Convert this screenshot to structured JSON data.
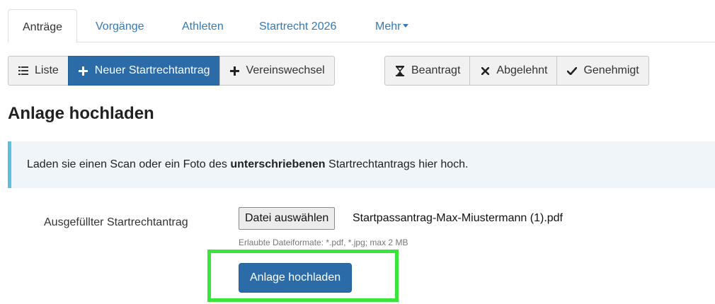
{
  "tabs": [
    {
      "label": "Anträge"
    },
    {
      "label": "Vorgänge"
    },
    {
      "label": "Athleten"
    },
    {
      "label": "Startrecht 2026"
    },
    {
      "label": "Mehr"
    }
  ],
  "toolbar": {
    "list": {
      "label": "Liste",
      "icon": "list-icon"
    },
    "new_application": {
      "label": "Neuer Startrechtantrag",
      "icon": "plus-icon"
    },
    "club_change": {
      "label": "Vereinswechsel",
      "icon": "plus-icon"
    },
    "requested": {
      "label": "Beantragt",
      "icon": "hourglass-icon"
    },
    "rejected": {
      "label": "Abgelehnt",
      "icon": "x-icon"
    },
    "approved": {
      "label": "Genehmigt",
      "icon": "check-icon"
    }
  },
  "page_title": "Anlage hochladen",
  "alert": {
    "text_before": "Laden sie einen Scan oder ein Foto des ",
    "text_bold": "unterschriebenen",
    "text_after": " Startrechtantrags hier hoch."
  },
  "form": {
    "label": "Ausgefüllter Startrechtantrag",
    "file_button": "Datei auswählen",
    "file_name": "Startpassantrag-Max-Miustermann (1).pdf",
    "help": "Erlaubte Dateiformate: *.pdf, *.jpg; max 2 MB",
    "submit": "Anlage hochladen"
  },
  "colors": {
    "primary": "#2a6ba8",
    "highlight": "#39e53b",
    "alert_border": "#5bc0de",
    "alert_bg": "#f0f5fa"
  }
}
